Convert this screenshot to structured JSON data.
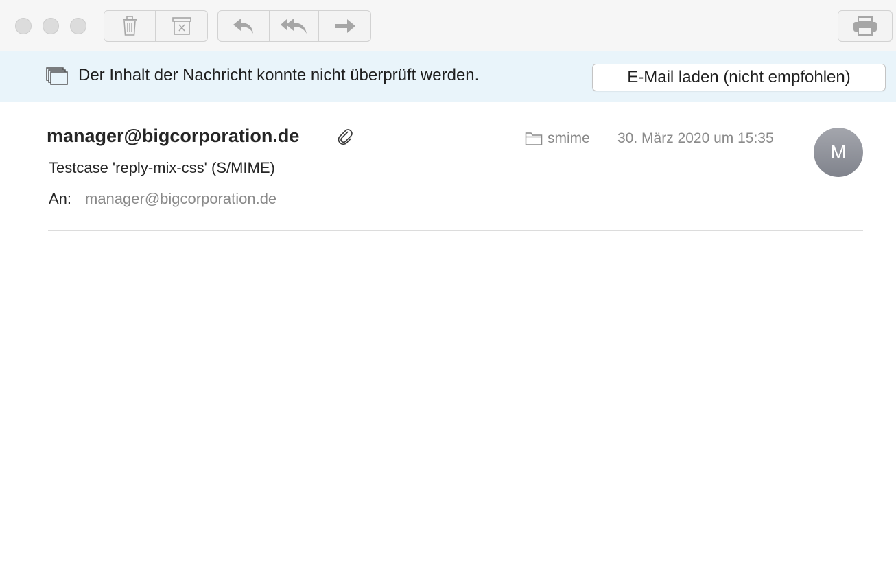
{
  "banner": {
    "message": "Der Inhalt der Nachricht konnte nicht überprüft werden.",
    "load_button_label": "E-Mail laden (nicht empfohlen)"
  },
  "message": {
    "sender": "manager@bigcorporation.de",
    "subject": "Testcase 'reply-mix-css' (S/MIME)",
    "to_label": "An:",
    "to_address": "manager@bigcorporation.de",
    "folder": "smime",
    "date": "30. März 2020 um 15:35",
    "avatar_initial": "M"
  },
  "icons": {
    "toolbar": [
      "trash-icon",
      "junk-icon",
      "reply-icon",
      "reply-all-icon",
      "forward-icon",
      "print-icon"
    ],
    "banner": "message-stack-icon",
    "header": [
      "attachment-icon",
      "folder-icon"
    ]
  },
  "colors": {
    "banner_background": "#e9f4fa",
    "toolbar_background": "#f6f6f6",
    "avatar": "#8d9098",
    "secondary_text": "#8a8a8a"
  }
}
